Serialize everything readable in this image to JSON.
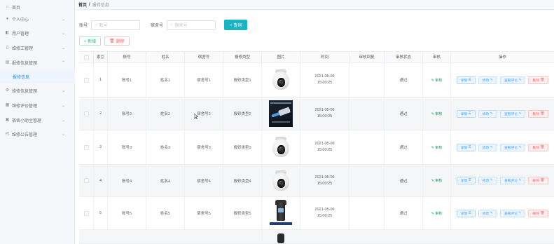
{
  "sidebar": {
    "items": [
      {
        "label": "首页",
        "icon": "home-icon"
      },
      {
        "label": "个人中心",
        "icon": "user-icon"
      },
      {
        "label": "用户管理",
        "icon": "users-icon"
      },
      {
        "label": "维修工管理",
        "icon": "wrench-icon"
      },
      {
        "label": "报修信息管理",
        "icon": "list-icon"
      },
      {
        "label": "报修信息",
        "icon": ""
      },
      {
        "label": "维修信息管理",
        "icon": "tools-icon"
      },
      {
        "label": "维修评价管理",
        "icon": "comment-icon"
      },
      {
        "label": "宿舍小助主管理",
        "icon": "home-alt-icon"
      },
      {
        "label": "维修公告管理",
        "icon": "notice-icon"
      }
    ]
  },
  "breadcrumb": {
    "home": "首页",
    "sep": "/",
    "current": "报修信息"
  },
  "search": {
    "label1": "账号",
    "placeholder1": "账号",
    "label2": "宿舍号",
    "placeholder2": "宿舍号",
    "button": "查询"
  },
  "actions": {
    "add": "+ 新增",
    "delete": "删除"
  },
  "table": {
    "headers": [
      "",
      "索引",
      "账号",
      "姓名",
      "宿舍号",
      "报修类型",
      "图片",
      "时间",
      "审核回复",
      "审核状态",
      "审核",
      "操作"
    ],
    "rows": [
      {
        "index": "1",
        "account": "账号1",
        "name": "姓名1",
        "dorm": "宿舍号1",
        "type": "报修类型1",
        "image": "camera",
        "time": "2021-05-06 15:00:25",
        "reply": "",
        "status": "通过",
        "audit": "审核"
      },
      {
        "index": "2",
        "account": "账号2",
        "name": "姓名2",
        "dorm": "宿舍号2",
        "type": "报修类型2",
        "image": "cable",
        "time": "2021-05-06 15:00:25",
        "reply": "",
        "status": "通过",
        "audit": "审核"
      },
      {
        "index": "3",
        "account": "账号3",
        "name": "姓名3",
        "dorm": "宿舍号3",
        "type": "报修类型3",
        "image": "camera",
        "time": "2021-05-06 15:00:25",
        "reply": "",
        "status": "通过",
        "audit": "审核"
      },
      {
        "index": "4",
        "account": "账号4",
        "name": "姓名4",
        "dorm": "宿舍号4",
        "type": "报修类型4",
        "image": "camera",
        "time": "2021-05-06 15:00:25",
        "reply": "",
        "status": "通过",
        "audit": "审核"
      },
      {
        "index": "5",
        "account": "账号5",
        "name": "姓名5",
        "dorm": "宿舍号5",
        "type": "报修类型5",
        "image": "recorder",
        "time": "2021-05-06 15:00:25",
        "reply": "",
        "status": "通过",
        "audit": "审核"
      }
    ],
    "ops": {
      "detail": "详情",
      "edit": "修改",
      "comment": "查看评论",
      "delete": "删除"
    }
  }
}
